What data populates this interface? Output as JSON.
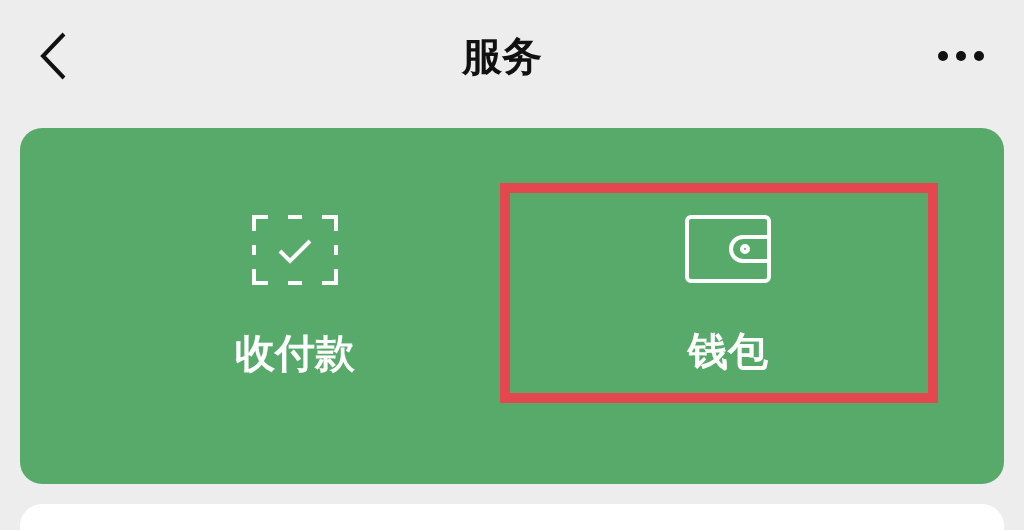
{
  "header": {
    "title": "服务"
  },
  "services": [
    {
      "label": "收付款",
      "kind": "scan",
      "highlighted": false
    },
    {
      "label": "钱包",
      "kind": "wallet",
      "highlighted": true
    }
  ]
}
